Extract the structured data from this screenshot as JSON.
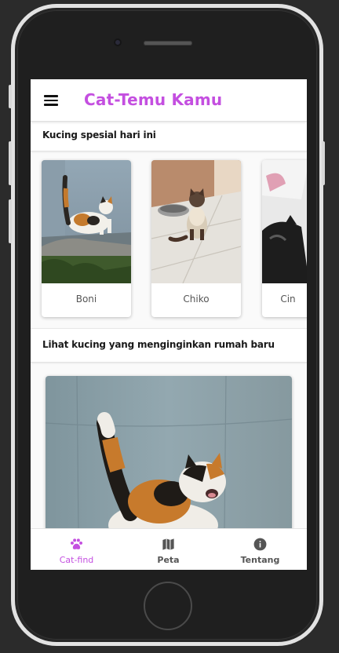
{
  "app": {
    "title": "Cat-Temu Kamu",
    "accent_color": "#c44fe0"
  },
  "toolbar": {
    "menu_icon": "hamburger-menu-icon"
  },
  "featured": {
    "heading": "Kucing spesial hari ini",
    "cats": [
      {
        "name": "Boni",
        "photo": "calico-cat-on-rock"
      },
      {
        "name": "Chiko",
        "photo": "siamese-cat-on-tiles"
      },
      {
        "name": "Cin",
        "photo": "black-white-cat-partial"
      }
    ]
  },
  "adoption": {
    "heading": "Lihat kucing yang menginginkan rumah baru",
    "photo": "calico-cat-meowing"
  },
  "bottom_nav": {
    "items": [
      {
        "label": "Cat-find",
        "icon": "paw-icon",
        "active": true
      },
      {
        "label": "Peta",
        "icon": "map-icon",
        "active": false
      },
      {
        "label": "Tentang",
        "icon": "info-icon",
        "active": false
      }
    ]
  }
}
